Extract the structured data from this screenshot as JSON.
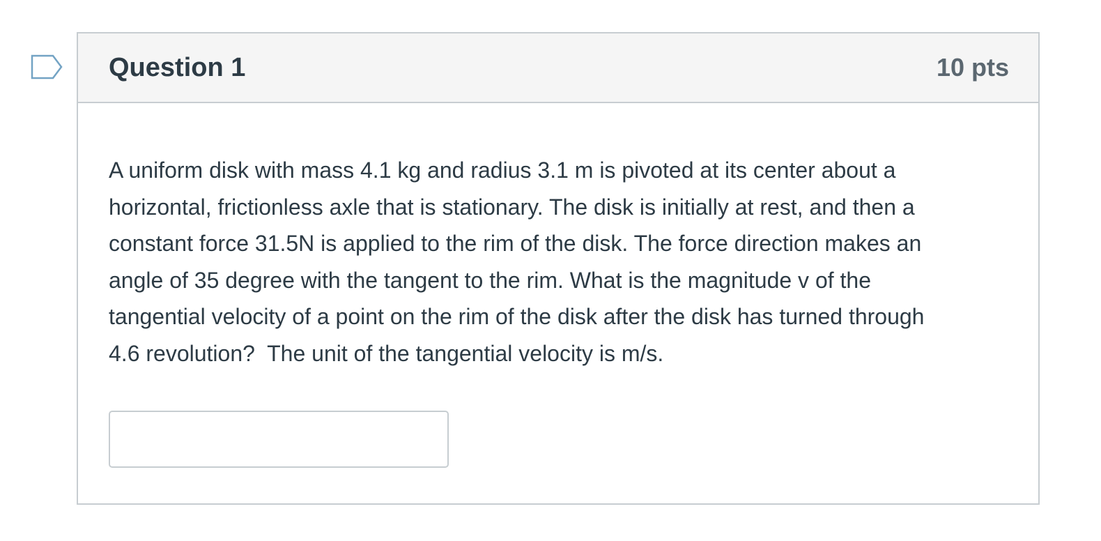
{
  "question": {
    "title": "Question 1",
    "points": "10 pts",
    "flag_icon": "bookmark-flag-icon",
    "text_lines": [
      "A uniform disk with mass 4.1 kg and radius 3.1 m is pivoted at its center about a",
      "horizontal, frictionless axle that is stationary. The disk is initially at rest, and then a",
      "constant force 31.5N is applied to the rim of the disk. The force direction makes an",
      "angle of 35 degree with the tangent to the rim. What is the magnitude v of the",
      "tangential velocity of a point on the rim of the disk after the disk has turned through",
      "4.6 revolution?  The unit of the tangential velocity is m/s."
    ],
    "answer": {
      "value": "",
      "placeholder": ""
    }
  },
  "colors": {
    "text": "#2d3b45",
    "border": "#c7cdd1",
    "header_bg": "#f5f5f5",
    "flag": "#73a3c4"
  }
}
